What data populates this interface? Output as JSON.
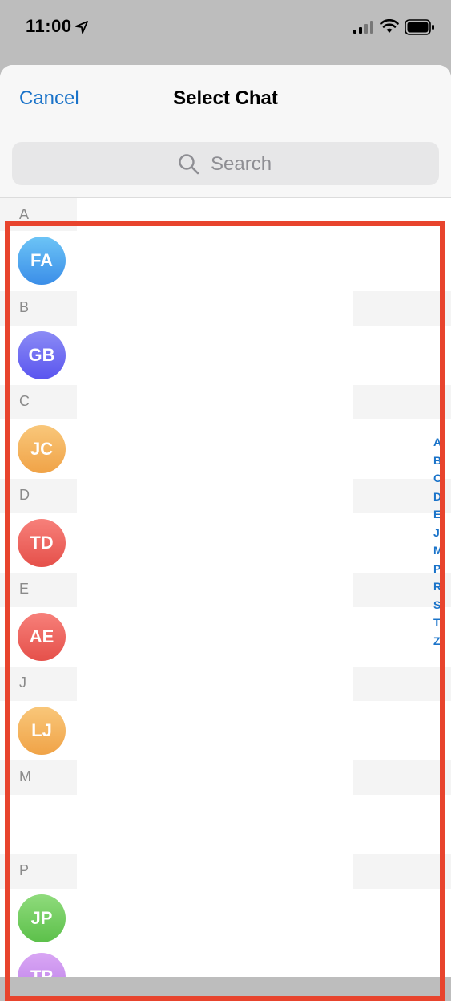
{
  "status_bar": {
    "time": "11:00"
  },
  "nav": {
    "cancel_label": "Cancel",
    "title": "Select Chat"
  },
  "search": {
    "placeholder": "Search"
  },
  "sections": [
    {
      "letter": "A",
      "initials": "FA"
    },
    {
      "letter": "B",
      "initials": "GB"
    },
    {
      "letter": "C",
      "initials": "JC"
    },
    {
      "letter": "D",
      "initials": "TD"
    },
    {
      "letter": "E",
      "initials": "AE"
    },
    {
      "letter": "J",
      "initials": "LJ"
    },
    {
      "letter": "M",
      "initials": ""
    },
    {
      "letter": "P",
      "initials": "JP"
    },
    {
      "letter": "",
      "initials": "TP"
    }
  ],
  "index": [
    "A",
    "B",
    "C",
    "D",
    "E",
    "J",
    "M",
    "P",
    "R",
    "S",
    "T",
    "Z"
  ],
  "colors": {
    "accent": "#1a73c9",
    "highlight": "#e8442d",
    "avatar_blue": [
      "#6cc4f6",
      "#3b8ee8"
    ],
    "avatar_purple": [
      "#8b8bf5",
      "#5a55ef"
    ],
    "avatar_orange": [
      "#f9c77a",
      "#f0a347"
    ],
    "avatar_red": [
      "#f7807a",
      "#e5504a"
    ],
    "avatar_green": [
      "#8fdb7c",
      "#5cc04a"
    ],
    "avatar_violet": [
      "#d9a6f4",
      "#bb7ee8"
    ]
  }
}
